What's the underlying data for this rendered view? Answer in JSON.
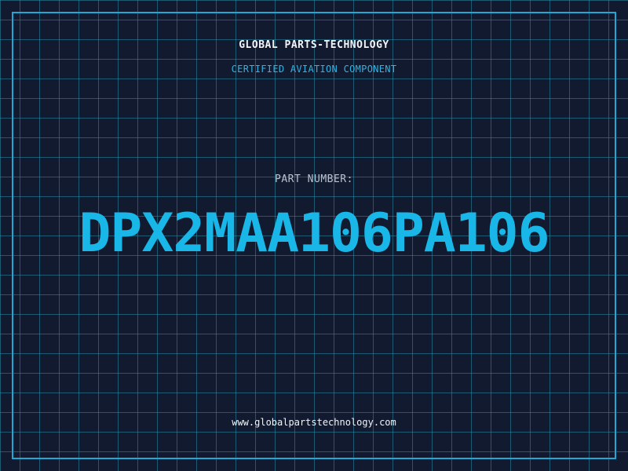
{
  "header": {
    "brand": "GLOBAL PARTS-TECHNOLOGY",
    "tagline": "CERTIFIED AVIATION COMPONENT"
  },
  "part": {
    "label": "PART NUMBER:",
    "number": "DPX2MAA106PA106"
  },
  "footer": {
    "url": "www.globalpartstechnology.com"
  },
  "colors": {
    "background": "#111a2e",
    "grid": "#288caa",
    "accent": "#19b6e8",
    "text": "#f2f4f8"
  }
}
